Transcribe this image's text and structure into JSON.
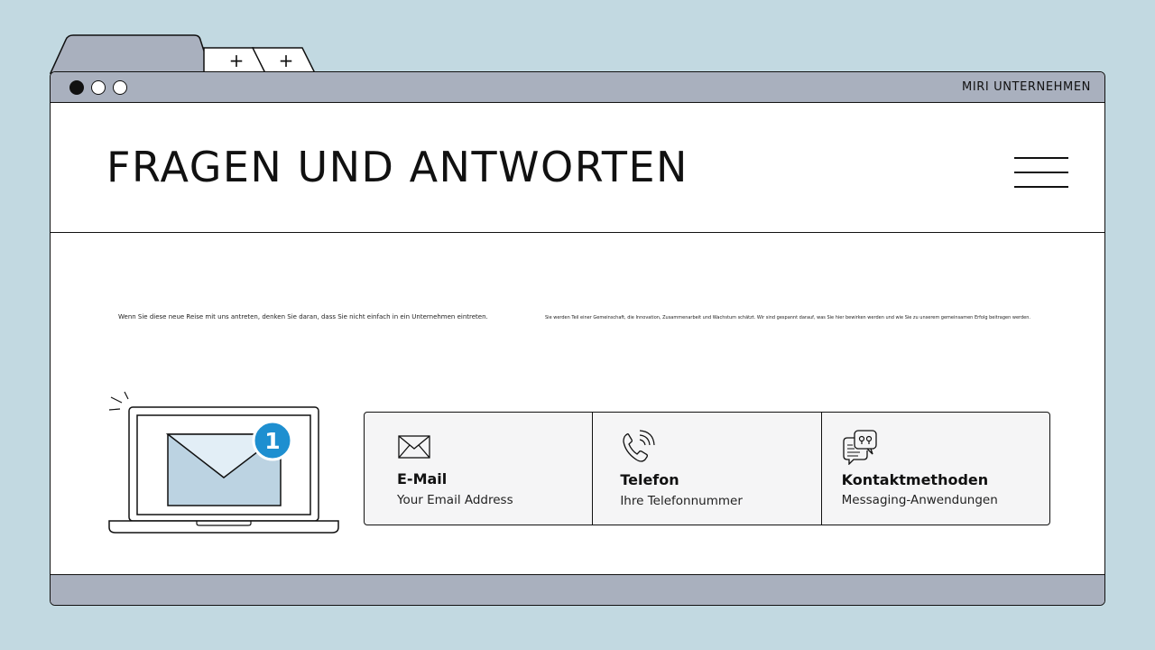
{
  "window": {
    "brand": "MIRI UNTERNEHMEN",
    "tabs": [
      {
        "label": "+"
      },
      {
        "label": "+"
      }
    ]
  },
  "header": {
    "title": "FRAGEN UND ANTWORTEN"
  },
  "intro": {
    "left": "Wenn Sie diese neue Reise mit uns antreten, denken Sie daran, dass Sie nicht einfach in ein Unternehmen eintreten.",
    "right": "Sie werden Teil einer Gemeinschaft, die Innovation, Zusammenarbeit und Wachstum schätzt. Wir sind gespannt darauf, was Sie hier bewirken werden und wie Sie zu unserem gemeinsamen Erfolg beitragen werden."
  },
  "illustration": {
    "notification_count": "1"
  },
  "contacts": [
    {
      "icon": "envelope-icon",
      "title": "E-Mail",
      "subtitle": "Your Email Address"
    },
    {
      "icon": "phone-icon",
      "title": "Telefon",
      "subtitle": "Ihre Telefonnummer"
    },
    {
      "icon": "chat-bubbles-icon",
      "title": "Kontaktmethoden",
      "subtitle": "Messaging-Anwendungen"
    }
  ],
  "colors": {
    "background": "#c2d9e1",
    "chrome": "#a9b0be",
    "panel": "#f5f5f6",
    "badge": "#1e8fd0",
    "envelope_fill": "#bcd3e2"
  }
}
